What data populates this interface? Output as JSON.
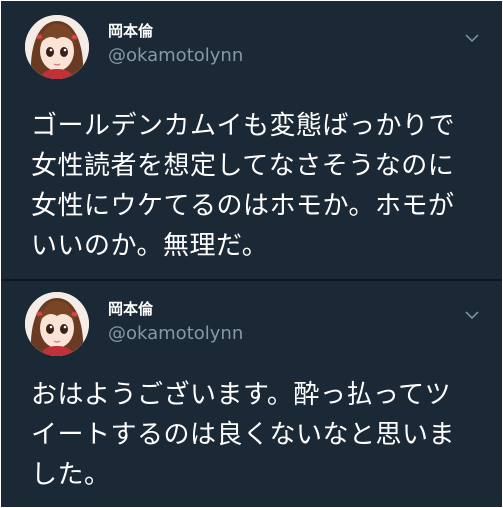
{
  "tweets": [
    {
      "author_name": "岡本倫",
      "author_handle": "@okamotolynn",
      "avatar_icon": "anime-girl-avatar-icon",
      "menu_icon": "chevron-down-icon",
      "lines": [
        "ゴールデンカムイも変態ばっかりで",
        "女性読者を想定してなさそうなのに",
        "女性にウケてるのはホモか。ホモが",
        "いいのか。無理だ。"
      ]
    },
    {
      "author_name": "岡本倫",
      "author_handle": "@okamotolynn",
      "avatar_icon": "anime-girl-avatar-icon",
      "menu_icon": "chevron-down-icon",
      "lines": [
        "おはようございます。酔っ払ってツ",
        "イートするのは良くないなと思いま",
        "した。"
      ]
    }
  ],
  "colors": {
    "background": "#1b2836",
    "text": "#ffffff",
    "secondary_text": "#8899a6"
  }
}
